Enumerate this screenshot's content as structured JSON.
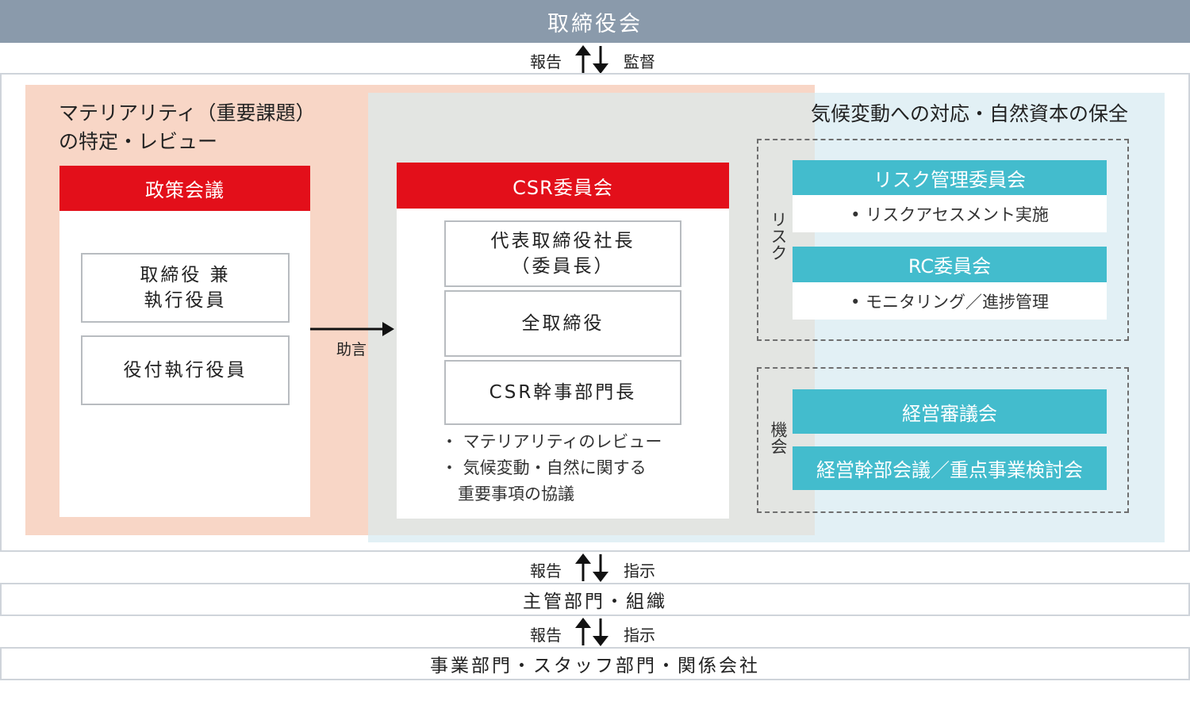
{
  "board": {
    "label": "取締役会"
  },
  "arrow_top": {
    "up_label": "報告",
    "down_label": "監督"
  },
  "materiality": {
    "title_line1": "マテリアリティ（重要課題）",
    "title_line2": "の特定・レビュー",
    "policy_header": "政策会議",
    "box1_line1": "取締役 兼",
    "box1_line2": "執行役員",
    "box2": "役付執行役員"
  },
  "advice_label": "助言",
  "csr": {
    "header": "CSR委員会",
    "box1_line1": "代表取締役社長",
    "box1_line2": "（委員長）",
    "box2": "全取締役",
    "box3": "CSR幹事部門長",
    "bullet1": "・ マテリアリティのレビュー",
    "bullet2": "・ 気候変動・自然に関する",
    "bullet2_cont": "重要事項の協議"
  },
  "climate": {
    "title": "気候変動への対応・自然資本の保全",
    "risk_label": "リスク",
    "risk_committee": "リスク管理委員会",
    "risk_committee_sub": "• リスクアセスメント実施",
    "rc_committee": "RC委員会",
    "rc_committee_sub": "• モニタリング／進捗管理",
    "opportunity_label": "機会",
    "mgmt_council": "経営審議会",
    "exec_meeting": "経営幹部会議／重点事業検討会"
  },
  "arrow_mid": {
    "up_label": "報告",
    "down_label": "指示"
  },
  "dept": {
    "label": "主管部門・組織"
  },
  "arrow_bottom": {
    "up_label": "報告",
    "down_label": "指示"
  },
  "business": {
    "label": "事業部門・スタッフ部門・関係会社"
  },
  "colors": {
    "board_gray": "#8a9aab",
    "header_red": "#e30f1a",
    "teal": "#43bccd",
    "materiality_bg": "#f8d6c6",
    "climate_bg": "#e2f0f5",
    "overlap_bg": "#e3e5e2"
  }
}
